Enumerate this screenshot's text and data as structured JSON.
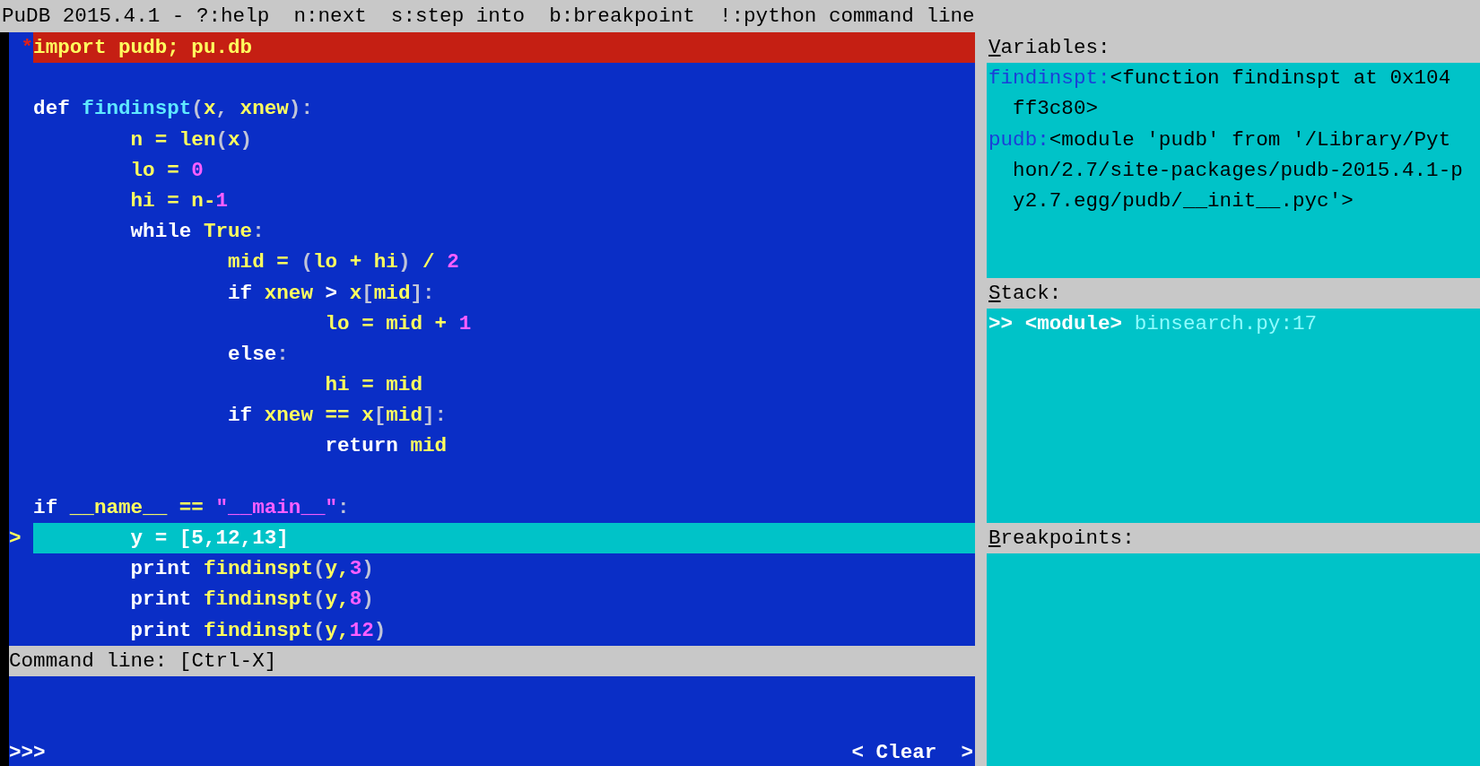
{
  "title_bar": "PuDB 2015.4.1 - ?:help  n:next  s:step into  b:breakpoint  !:python command line",
  "code_lines": [
    {
      "marker": "*",
      "breakpoint": true,
      "current": false,
      "tokens": [
        {
          "kind": "kw",
          "text": "import"
        },
        {
          "kind": "name",
          "text": " pudb; pu.db"
        }
      ]
    },
    {
      "breakpoint": false,
      "current": false
    },
    {
      "breakpoint": false,
      "current": false,
      "tokens": [
        {
          "kind": "kw",
          "text": "def "
        },
        {
          "kind": "fn",
          "text": "findinspt"
        },
        {
          "kind": "punct",
          "text": "("
        },
        {
          "kind": "name",
          "text": "x"
        },
        {
          "kind": "punct",
          "text": ", "
        },
        {
          "kind": "name",
          "text": "xnew"
        },
        {
          "kind": "punct",
          "text": "):"
        }
      ]
    },
    {
      "breakpoint": false,
      "current": false,
      "tokens": [
        {
          "kind": "name",
          "text": "        n = len"
        },
        {
          "kind": "punct",
          "text": "("
        },
        {
          "kind": "name",
          "text": "x"
        },
        {
          "kind": "punct",
          "text": ")"
        }
      ]
    },
    {
      "breakpoint": false,
      "current": false,
      "tokens": [
        {
          "kind": "name",
          "text": "        lo = "
        },
        {
          "kind": "num",
          "text": "0"
        }
      ]
    },
    {
      "breakpoint": false,
      "current": false,
      "tokens": [
        {
          "kind": "name",
          "text": "        hi = n-"
        },
        {
          "kind": "num",
          "text": "1"
        }
      ]
    },
    {
      "breakpoint": false,
      "current": false,
      "tokens": [
        {
          "kind": "kw",
          "text": "        while"
        },
        {
          "kind": "name",
          "text": " True"
        },
        {
          "kind": "punct",
          "text": ":"
        }
      ]
    },
    {
      "breakpoint": false,
      "current": false,
      "tokens": [
        {
          "kind": "name",
          "text": "                mid = "
        },
        {
          "kind": "punct",
          "text": "("
        },
        {
          "kind": "name",
          "text": "lo + hi"
        },
        {
          "kind": "punct",
          "text": ")"
        },
        {
          "kind": "name",
          "text": " / "
        },
        {
          "kind": "num",
          "text": "2"
        }
      ]
    },
    {
      "breakpoint": false,
      "current": false,
      "tokens": [
        {
          "kind": "kw",
          "text": "                if"
        },
        {
          "kind": "name",
          "text": " xnew"
        },
        {
          "kind": "kw",
          "text": " > "
        },
        {
          "kind": "name",
          "text": "x"
        },
        {
          "kind": "punct",
          "text": "["
        },
        {
          "kind": "name",
          "text": "mid"
        },
        {
          "kind": "punct",
          "text": "]:"
        }
      ]
    },
    {
      "breakpoint": false,
      "current": false,
      "tokens": [
        {
          "kind": "name",
          "text": "                        lo = mid + "
        },
        {
          "kind": "num",
          "text": "1"
        }
      ]
    },
    {
      "breakpoint": false,
      "current": false,
      "tokens": [
        {
          "kind": "kw",
          "text": "                else"
        },
        {
          "kind": "punct",
          "text": ":"
        }
      ]
    },
    {
      "breakpoint": false,
      "current": false,
      "tokens": [
        {
          "kind": "name",
          "text": "                        hi = mid"
        }
      ]
    },
    {
      "breakpoint": false,
      "current": false,
      "tokens": [
        {
          "kind": "kw",
          "text": "                if"
        },
        {
          "kind": "name",
          "text": " xnew == x"
        },
        {
          "kind": "punct",
          "text": "["
        },
        {
          "kind": "name",
          "text": "mid"
        },
        {
          "kind": "punct",
          "text": "]:"
        }
      ]
    },
    {
      "breakpoint": false,
      "current": false,
      "tokens": [
        {
          "kind": "kw",
          "text": "                        return"
        },
        {
          "kind": "name",
          "text": " mid"
        }
      ]
    },
    {
      "breakpoint": false,
      "current": false
    },
    {
      "breakpoint": false,
      "current": false,
      "tokens": [
        {
          "kind": "kw",
          "text": "if"
        },
        {
          "kind": "name",
          "text": " __name__ == "
        },
        {
          "kind": "str",
          "text": "\"__main__\""
        },
        {
          "kind": "punct",
          "text": ":"
        }
      ]
    },
    {
      "marker": ">",
      "breakpoint": false,
      "current": true,
      "tokens": [
        {
          "kind": "name",
          "text": "        y = [5,12,13]"
        }
      ]
    },
    {
      "breakpoint": false,
      "current": false,
      "tokens": [
        {
          "kind": "kw",
          "text": "        print"
        },
        {
          "kind": "name",
          "text": " findinspt"
        },
        {
          "kind": "punct",
          "text": "("
        },
        {
          "kind": "name",
          "text": "y,"
        },
        {
          "kind": "num",
          "text": "3"
        },
        {
          "kind": "punct",
          "text": ")"
        }
      ]
    },
    {
      "breakpoint": false,
      "current": false,
      "tokens": [
        {
          "kind": "kw",
          "text": "        print"
        },
        {
          "kind": "name",
          "text": " findinspt"
        },
        {
          "kind": "punct",
          "text": "("
        },
        {
          "kind": "name",
          "text": "y,"
        },
        {
          "kind": "num",
          "text": "8"
        },
        {
          "kind": "punct",
          "text": ")"
        }
      ]
    },
    {
      "breakpoint": false,
      "current": false,
      "tokens": [
        {
          "kind": "kw",
          "text": "        print"
        },
        {
          "kind": "name",
          "text": " findinspt"
        },
        {
          "kind": "punct",
          "text": "("
        },
        {
          "kind": "name",
          "text": "y,"
        },
        {
          "kind": "num",
          "text": "12"
        },
        {
          "kind": "punct",
          "text": ")"
        }
      ]
    }
  ],
  "command_line": {
    "header": "Command line: [Ctrl-X]",
    "prompt": ">>>",
    "clear_button": "< Clear  >"
  },
  "variables": {
    "hotkey": "V",
    "header": "ariables:",
    "items": [
      {
        "name": "findinspt:",
        "value_lines": [
          "<function findinspt at 0x104",
          "ff3c80>"
        ]
      },
      {
        "name": "pudb:",
        "value_lines": [
          "<module 'pudb' from '/Library/Pyt",
          "hon/2.7/site-packages/pudb-2015.4.1-p",
          "y2.7.egg/pudb/__init__.pyc'>"
        ]
      }
    ]
  },
  "stack": {
    "hotkey": "S",
    "header": "tack:",
    "frames": [
      {
        "marker": ">>",
        "function": "<module>",
        "location": "binsearch.py:17"
      }
    ]
  },
  "breakpoints": {
    "hotkey": "B",
    "header": "reakpoints:"
  }
}
